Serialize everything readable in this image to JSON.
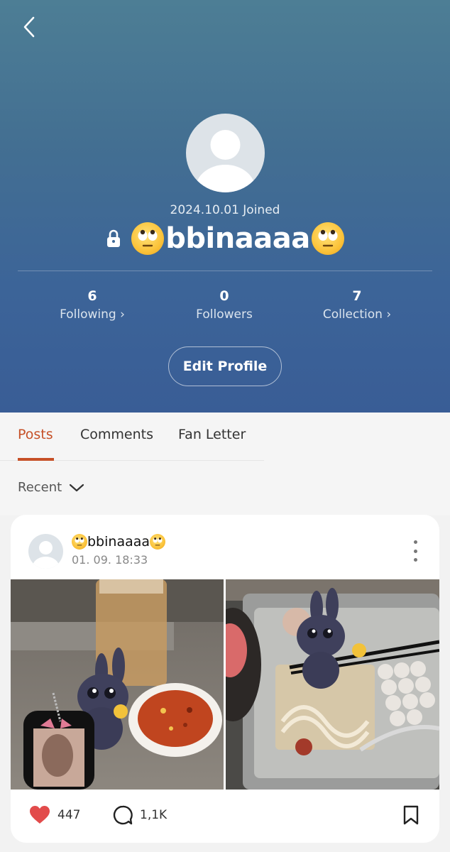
{
  "profile": {
    "joined": "2024.10.01 Joined",
    "username": "bbinaaaa"
  },
  "stats": [
    {
      "count": "6",
      "label": "Following",
      "arrow": "›"
    },
    {
      "count": "0",
      "label": "Followers",
      "arrow": ""
    },
    {
      "count": "7",
      "label": "Collection",
      "arrow": "›"
    }
  ],
  "edit_profile_label": "Edit Profile",
  "tabs": [
    {
      "label": "Posts"
    },
    {
      "label": "Comments"
    },
    {
      "label": "Fan Letter"
    }
  ],
  "sort_label": "Recent",
  "post": {
    "author": "bbinaaaa",
    "time": "01. 09. 18:33",
    "likes": "447",
    "comments": "1,1K"
  },
  "colors": {
    "accent": "#c65027",
    "like": "#e24b4b",
    "header_top": "#4d7e95",
    "header_bottom": "#395d96"
  },
  "icons": {
    "back": "chevron-left-icon",
    "lock": "lock-icon",
    "sort": "chevron-down-icon",
    "more": "more-vertical-icon",
    "like": "heart-icon",
    "comment": "comment-bubble-icon",
    "save": "bookmark-icon",
    "emoji": "eye-roll-emoji"
  }
}
